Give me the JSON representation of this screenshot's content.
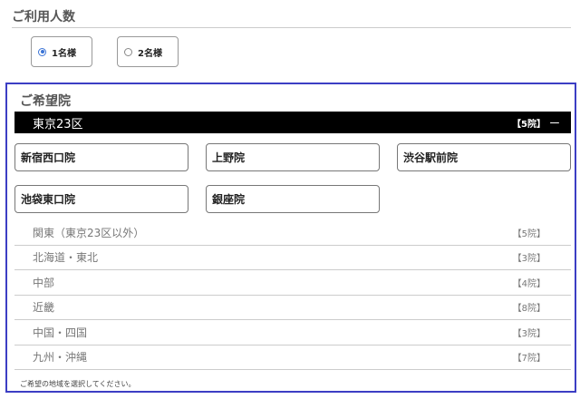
{
  "people": {
    "title": "ご利用人数",
    "options": [
      {
        "label": "1名様",
        "checked": true
      },
      {
        "label": "2名様",
        "checked": false
      }
    ]
  },
  "clinic": {
    "title": "ご希望院",
    "open_region": {
      "name": "東京23区",
      "count": "【5院】",
      "toggle": "ー",
      "clinics": [
        "新宿西口院",
        "上野院",
        "渋谷駅前院",
        "池袋東口院",
        "銀座院"
      ]
    },
    "regions": [
      {
        "name": "関東（東京23区以外）",
        "count": "【5院】"
      },
      {
        "name": "北海道・東北",
        "count": "【3院】"
      },
      {
        "name": "中部",
        "count": "【4院】"
      },
      {
        "name": "近畿",
        "count": "【8院】"
      },
      {
        "name": "中国・四国",
        "count": "【3院】"
      },
      {
        "name": "九州・沖縄",
        "count": "【7院】"
      }
    ],
    "hint": "ご希望の地域を選択してください。"
  },
  "colors": {
    "panel_border": "#3c3ec4",
    "radio_accent": "#3b74d6",
    "open_region_bg": "#000000"
  }
}
